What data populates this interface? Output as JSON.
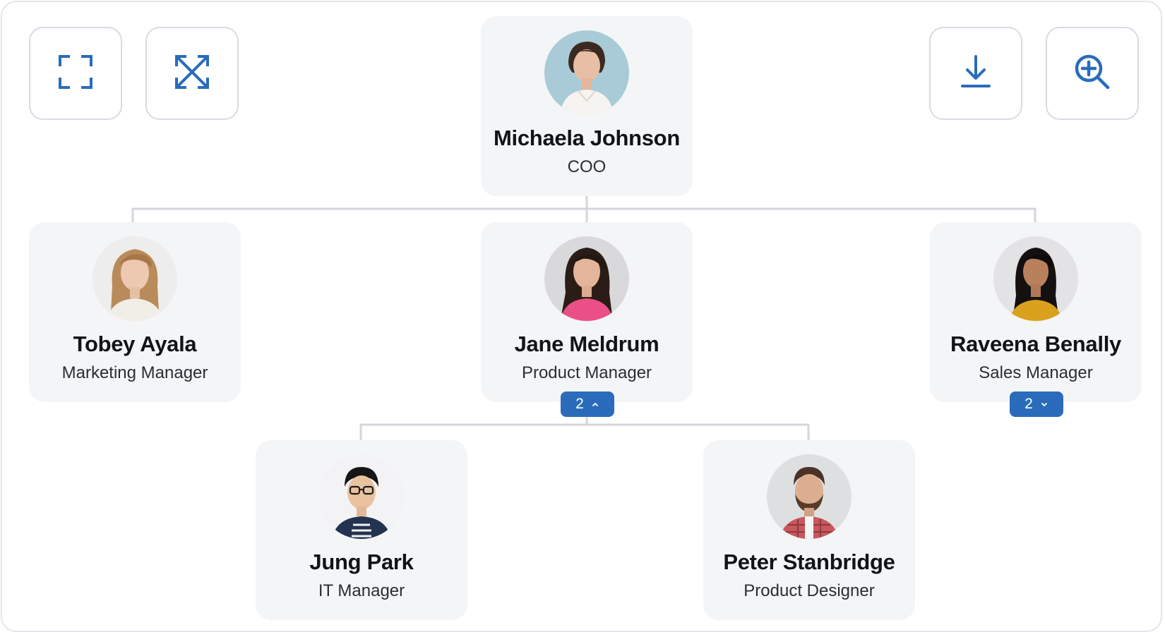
{
  "toolbar": {
    "fit_icon": "fit-screen-icon",
    "expand_icon": "expand-all-icon",
    "download_icon": "download-icon",
    "zoom_icon": "zoom-in-icon"
  },
  "colors": {
    "accent": "#2a6cbb",
    "card_bg": "#f4f5f7",
    "connector": "#d5d6dc",
    "border": "#d9dbe3"
  },
  "org_chart": {
    "root": {
      "name": "Michaela Johnson",
      "title": "COO",
      "avatar": "avatar-photo"
    },
    "level1": [
      {
        "name": "Tobey Ayala",
        "title": "Marketing Manager",
        "avatar": "avatar-photo"
      },
      {
        "name": "Jane Meldrum",
        "title": "Product Manager",
        "avatar": "avatar-photo",
        "reports_count": "2",
        "expanded": true
      },
      {
        "name": "Raveena Benally",
        "title": "Sales Manager",
        "avatar": "avatar-photo",
        "reports_count": "2",
        "expanded": false
      }
    ],
    "level2": [
      {
        "name": "Jung Park",
        "title": "IT Manager",
        "avatar": "avatar-photo"
      },
      {
        "name": "Peter Stanbridge",
        "title": "Product Designer",
        "avatar": "avatar-photo"
      }
    ]
  }
}
